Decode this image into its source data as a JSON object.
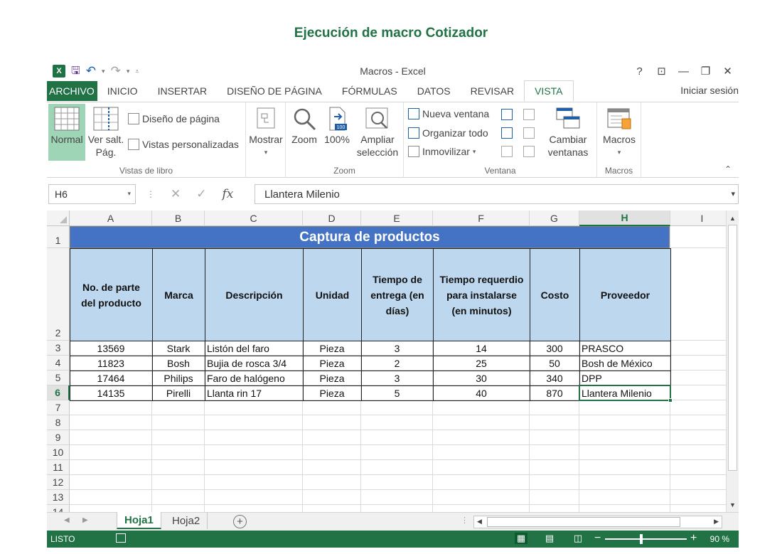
{
  "page_title": "Ejecución de macro Cotizador",
  "window": {
    "title": "Macros - Excel",
    "controls": [
      "?",
      "⊡",
      "—",
      "❐",
      "✕"
    ]
  },
  "tabs": [
    "ARCHIVO",
    "INICIO",
    "INSERTAR",
    "DISEÑO DE PÁGINA",
    "FÓRMULAS",
    "DATOS",
    "REVISAR",
    "VISTA"
  ],
  "active_tab": "VISTA",
  "signin": "Iniciar sesión",
  "ribbon": {
    "vistas": {
      "label": "Vistas de libro",
      "normal": "Normal",
      "ver_salt_1": "Ver salt.",
      "ver_salt_2": "Pág.",
      "diseno": "Diseño de página",
      "personalizadas": "Vistas personalizadas"
    },
    "mostrar": {
      "label": "Mostrar"
    },
    "zoom": {
      "label": "Zoom",
      "zoom": "Zoom",
      "cien": "100%",
      "ampliar_1": "Ampliar",
      "ampliar_2": "selección"
    },
    "ventana": {
      "label": "Ventana",
      "nueva": "Nueva ventana",
      "organizar": "Organizar todo",
      "inmovilizar": "Inmovilizar",
      "cambiar_1": "Cambiar",
      "cambiar_2": "ventanas"
    },
    "macros": {
      "label": "Macros",
      "macros": "Macros"
    }
  },
  "formula_bar": {
    "name_box": "H6",
    "fx": "fx",
    "value": "Llantera Milenio"
  },
  "columns": [
    "A",
    "B",
    "C",
    "D",
    "E",
    "F",
    "G",
    "H",
    "I"
  ],
  "active_column": "H",
  "rows": [
    "1",
    "2",
    "3",
    "4",
    "5",
    "6",
    "7",
    "8",
    "9",
    "10",
    "11",
    "12",
    "13",
    "14"
  ],
  "active_row": "6",
  "table": {
    "title": "Captura de productos",
    "headers": [
      "No. de parte\ndel producto",
      "Marca",
      "Descripción",
      "Unidad",
      "Tiempo de\nentrega (en\ndías)",
      "Tiempo requerdio\npara instalarse\n(en minutos)",
      "Costo",
      "Proveedor"
    ],
    "rows": [
      [
        "13569",
        "Stark",
        "Listón del faro",
        "Pieza",
        "3",
        "14",
        "300",
        "PRASCO"
      ],
      [
        "11823",
        "Bosh",
        "Bujia de rosca 3/4",
        "Pieza",
        "2",
        "25",
        "50",
        "Bosh de México"
      ],
      [
        "17464",
        "Philips",
        "Faro de halógeno",
        "Pieza",
        "3",
        "30",
        "340",
        "DPP"
      ],
      [
        "14135",
        "Pirelli",
        "Llanta rin 17",
        "Pieza",
        "5",
        "40",
        "870",
        "Llantera Milenio"
      ]
    ]
  },
  "sheets": [
    "Hoja1",
    "Hoja2"
  ],
  "active_sheet": "Hoja1",
  "status": {
    "text": "LISTO",
    "zoom": "90 %"
  },
  "colors": {
    "excel_green": "#217346",
    "title_fill": "#4472c4",
    "header_fill": "#bdd7ee"
  }
}
